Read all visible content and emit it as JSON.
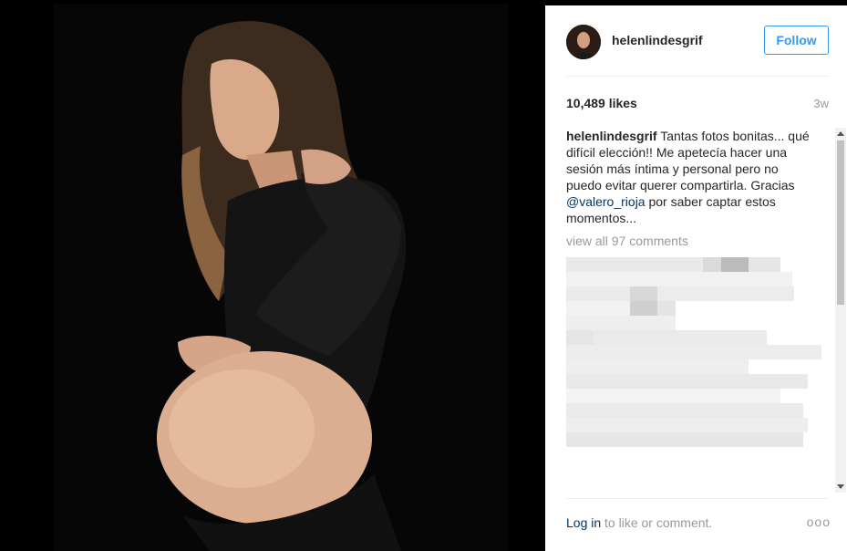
{
  "post": {
    "username": "helenlindesgrif",
    "follow_label": "Follow",
    "likes": "10,489 likes",
    "time": "3w",
    "caption_user": "helenlindesgrif",
    "caption_text_1": " Tantas fotos bonitas... qué difícil elección!! Me apetecía hacer una sesión más íntima y personal pero no puedo evitar querer compartirla. Gracias ",
    "caption_mention": "@valero_rioja",
    "caption_text_2": " por saber captar estos momentos...",
    "view_all": "view all 97 comments",
    "login_label": "Log in",
    "login_rest": " to like or comment.",
    "more_label": "ooo"
  },
  "colors": {
    "accent": "#3897f0",
    "link": "#003569",
    "muted": "#999999",
    "text": "#262626"
  },
  "icons": {
    "more": "more-options-icon",
    "avatar": "profile-avatar"
  }
}
